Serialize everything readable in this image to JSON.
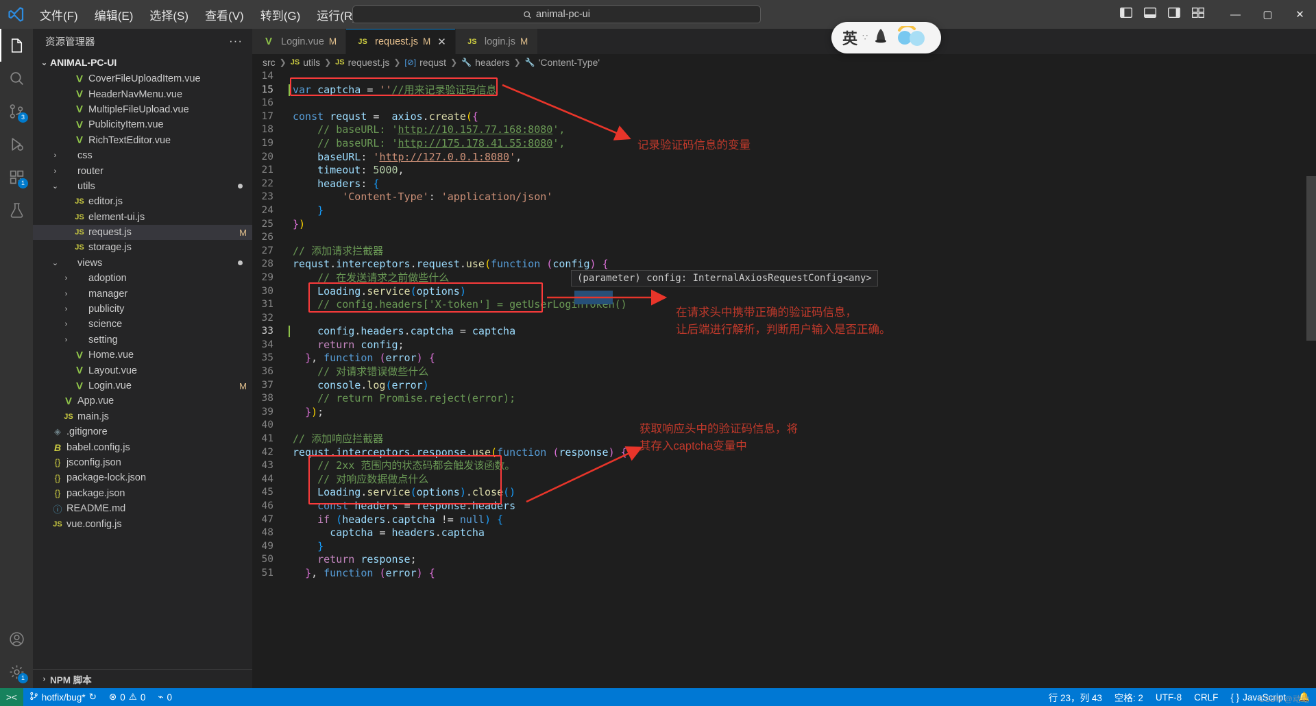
{
  "titlebar": {
    "menus": [
      "文件(F)",
      "编辑(E)",
      "选择(S)",
      "查看(V)",
      "转到(G)",
      "运行(R)"
    ],
    "more": "···",
    "search_placeholder": "animal-pc-ui",
    "search_icon": "search-icon",
    "back_icon": "←",
    "forward_icon": "→",
    "minimize": "—",
    "maximize": "▢",
    "close": "✕"
  },
  "activitybar": {
    "items": [
      {
        "name": "explorer",
        "badge": ""
      },
      {
        "name": "search",
        "badge": ""
      },
      {
        "name": "source-control",
        "badge": "3"
      },
      {
        "name": "run-debug",
        "badge": ""
      },
      {
        "name": "extensions",
        "badge": "1"
      },
      {
        "name": "testing",
        "badge": ""
      }
    ],
    "bottom": [
      {
        "name": "account",
        "badge": ""
      },
      {
        "name": "settings",
        "badge": "1"
      }
    ]
  },
  "sidebar": {
    "title": "资源管理器",
    "more": "···",
    "root": "ANIMAL-PC-UI",
    "root_twisty": "⌄",
    "tree": [
      {
        "indent": 2,
        "twisty": "",
        "icon": "vue",
        "label": "CoverFileUploadItem.vue",
        "mod": ""
      },
      {
        "indent": 2,
        "twisty": "",
        "icon": "vue",
        "label": "HeaderNavMenu.vue",
        "mod": ""
      },
      {
        "indent": 2,
        "twisty": "",
        "icon": "vue",
        "label": "MultipleFileUpload.vue",
        "mod": ""
      },
      {
        "indent": 2,
        "twisty": "",
        "icon": "vue",
        "label": "PublicityItem.vue",
        "mod": ""
      },
      {
        "indent": 2,
        "twisty": "",
        "icon": "vue",
        "label": "RichTextEditor.vue",
        "mod": ""
      },
      {
        "indent": 1,
        "twisty": "›",
        "icon": "",
        "label": "css",
        "mod": ""
      },
      {
        "indent": 1,
        "twisty": "›",
        "icon": "",
        "label": "router",
        "mod": ""
      },
      {
        "indent": 1,
        "twisty": "⌄",
        "icon": "",
        "label": "utils",
        "mod": "",
        "dot": true
      },
      {
        "indent": 2,
        "twisty": "",
        "icon": "js",
        "label": "editor.js",
        "mod": ""
      },
      {
        "indent": 2,
        "twisty": "",
        "icon": "js",
        "label": "element-ui.js",
        "mod": ""
      },
      {
        "indent": 2,
        "twisty": "",
        "icon": "js",
        "label": "request.js",
        "mod": "M",
        "selected": true
      },
      {
        "indent": 2,
        "twisty": "",
        "icon": "js",
        "label": "storage.js",
        "mod": ""
      },
      {
        "indent": 1,
        "twisty": "⌄",
        "icon": "",
        "label": "views",
        "mod": "",
        "dot": true
      },
      {
        "indent": 2,
        "twisty": "›",
        "icon": "",
        "label": "adoption",
        "mod": ""
      },
      {
        "indent": 2,
        "twisty": "›",
        "icon": "",
        "label": "manager",
        "mod": ""
      },
      {
        "indent": 2,
        "twisty": "›",
        "icon": "",
        "label": "publicity",
        "mod": ""
      },
      {
        "indent": 2,
        "twisty": "›",
        "icon": "",
        "label": "science",
        "mod": ""
      },
      {
        "indent": 2,
        "twisty": "›",
        "icon": "",
        "label": "setting",
        "mod": ""
      },
      {
        "indent": 2,
        "twisty": "",
        "icon": "vue",
        "label": "Home.vue",
        "mod": ""
      },
      {
        "indent": 2,
        "twisty": "",
        "icon": "vue",
        "label": "Layout.vue",
        "mod": ""
      },
      {
        "indent": 2,
        "twisty": "",
        "icon": "vue",
        "label": "Login.vue",
        "mod": "M"
      },
      {
        "indent": 1,
        "twisty": "",
        "icon": "vue",
        "label": "App.vue",
        "mod": ""
      },
      {
        "indent": 1,
        "twisty": "",
        "icon": "js",
        "label": "main.js",
        "mod": ""
      },
      {
        "indent": 0,
        "twisty": "",
        "icon": "git",
        "label": ".gitignore",
        "mod": ""
      },
      {
        "indent": 0,
        "twisty": "",
        "icon": "babel",
        "label": "babel.config.js",
        "mod": ""
      },
      {
        "indent": 0,
        "twisty": "",
        "icon": "json",
        "label": "jsconfig.json",
        "mod": ""
      },
      {
        "indent": 0,
        "twisty": "",
        "icon": "json",
        "label": "package-lock.json",
        "mod": ""
      },
      {
        "indent": 0,
        "twisty": "",
        "icon": "json",
        "label": "package.json",
        "mod": ""
      },
      {
        "indent": 0,
        "twisty": "",
        "icon": "md",
        "label": "README.md",
        "mod": ""
      },
      {
        "indent": 0,
        "twisty": "",
        "icon": "js",
        "label": "vue.config.js",
        "mod": ""
      }
    ],
    "npm_scripts": "NPM 脚本",
    "npm_twisty": "›"
  },
  "tabs": [
    {
      "icon": "vue",
      "label": "Login.vue",
      "mod": "M",
      "active": false,
      "close": ""
    },
    {
      "icon": "js",
      "label": "request.js",
      "mod": "M",
      "active": true,
      "close": "✕"
    },
    {
      "icon": "js",
      "label": "login.js",
      "mod": "M",
      "active": false,
      "close": ""
    }
  ],
  "breadcrumbs": [
    {
      "icon": "",
      "label": "src"
    },
    {
      "icon": "js",
      "label": "utils"
    },
    {
      "icon": "js",
      "label": "request.js"
    },
    {
      "icon": "object",
      "label": "requst"
    },
    {
      "icon": "prop",
      "label": "headers"
    },
    {
      "icon": "prop",
      "label": "'Content-Type'"
    }
  ],
  "editor": {
    "first_line": 14,
    "cursor_lines": [
      15,
      33
    ],
    "lines": [
      {
        "n": 14,
        "html": ""
      },
      {
        "n": 15,
        "html": "<span class=\"k\">var</span> <span class=\"v\">captcha</span> <span class=\"p\">=</span> <span class=\"s\">''</span><span class=\"c\">//用来记录验证码信息</span>"
      },
      {
        "n": 16,
        "html": ""
      },
      {
        "n": 17,
        "html": "<span class=\"k\">const</span> <span class=\"v\">requst</span> <span class=\"p\">=</span>  <span class=\"v\">axios</span><span class=\"p\">.</span><span class=\"f\">create</span><span class=\"br1\">(</span><span class=\"br2\">{</span>"
      },
      {
        "n": 18,
        "html": "    <span class=\"c\">// baseURL: '</span><span class=\"lnk\">http://10.157.77.168:8080</span><span class=\"c\">',</span>"
      },
      {
        "n": 19,
        "html": "    <span class=\"c\">// baseURL: '</span><span class=\"lnk\">http://175.178.41.55:8080</span><span class=\"c\">',</span>"
      },
      {
        "n": 20,
        "html": "    <span class=\"v\">baseURL</span><span class=\"p\">:</span> <span class=\"s\">'</span><span class=\"lnks\">http://127.0.0.1:8080</span><span class=\"s\">'</span><span class=\"p\">,</span>"
      },
      {
        "n": 21,
        "html": "    <span class=\"v\">timeout</span><span class=\"p\">:</span> <span class=\"n\">5000</span><span class=\"p\">,</span>"
      },
      {
        "n": 22,
        "html": "    <span class=\"v\">headers</span><span class=\"p\">:</span> <span class=\"br3\">{</span>"
      },
      {
        "n": 23,
        "html": "        <span class=\"s\">'Content-Type'</span><span class=\"p\">:</span> <span class=\"s\">'application/json'</span>"
      },
      {
        "n": 24,
        "html": "    <span class=\"br3\">}</span>"
      },
      {
        "n": 25,
        "html": "<span class=\"br2\">}</span><span class=\"br1\">)</span>"
      },
      {
        "n": 26,
        "html": ""
      },
      {
        "n": 27,
        "html": "<span class=\"c\">// 添加请求拦截器</span>"
      },
      {
        "n": 28,
        "html": "<span class=\"v\">requst</span><span class=\"p\">.</span><span class=\"v\">interceptors</span><span class=\"p\">.</span><span class=\"v\">request</span><span class=\"p\">.</span><span class=\"f\">use</span><span class=\"br1\">(</span><span class=\"k\">function</span> <span class=\"br2\">(</span><span class=\"v\">config</span><span class=\"br2\">)</span> <span class=\"br2\">{</span>"
      },
      {
        "n": 29,
        "html": "    <span class=\"c\">// 在发送请求之前做些什么</span>"
      },
      {
        "n": 30,
        "html": "    <span class=\"v\">Loading</span><span class=\"p\">.</span><span class=\"f\">service</span><span class=\"br3\">(</span><span class=\"v\">options</span><span class=\"br3\">)</span>"
      },
      {
        "n": 31,
        "html": "    <span class=\"c\">// config.headers['X-token'] = getUserLoginToken()</span>"
      },
      {
        "n": 32,
        "html": ""
      },
      {
        "n": 33,
        "html": "    <span class=\"v\">config</span><span class=\"p\">.</span><span class=\"v\">headers</span><span class=\"p\">.</span><span class=\"v\">captcha</span> <span class=\"p\">=</span> <span class=\"v\">captcha</span>"
      },
      {
        "n": 34,
        "html": "    <span class=\"kp\">return</span> <span class=\"v\">config</span><span class=\"p\">;</span>"
      },
      {
        "n": 35,
        "html": "  <span class=\"br2\">}</span><span class=\"p\">,</span> <span class=\"k\">function</span> <span class=\"br2\">(</span><span class=\"v\">error</span><span class=\"br2\">)</span> <span class=\"br2\">{</span>"
      },
      {
        "n": 36,
        "html": "    <span class=\"c\">// 对请求错误做些什么</span>"
      },
      {
        "n": 37,
        "html": "    <span class=\"v\">console</span><span class=\"p\">.</span><span class=\"f\">log</span><span class=\"br3\">(</span><span class=\"v\">error</span><span class=\"br3\">)</span>"
      },
      {
        "n": 38,
        "html": "    <span class=\"c\">// return Promise.reject(error);</span>"
      },
      {
        "n": 39,
        "html": "  <span class=\"br2\">}</span><span class=\"br1\">)</span><span class=\"p\">;</span>"
      },
      {
        "n": 40,
        "html": ""
      },
      {
        "n": 41,
        "html": "<span class=\"c\">// 添加响应拦截器</span>"
      },
      {
        "n": 42,
        "html": "<span class=\"v\">requst</span><span class=\"p\">.</span><span class=\"v\">interceptors</span><span class=\"p\">.</span><span class=\"v\">response</span><span class=\"p\">.</span><span class=\"f\">use</span><span class=\"br1\">(</span><span class=\"k\">function</span> <span class=\"br2\">(</span><span class=\"v\">response</span><span class=\"br2\">)</span> <span class=\"br2\">{</span>"
      },
      {
        "n": 43,
        "html": "    <span class=\"c\">// 2xx 范围内的状态码都会触发该函数。</span>"
      },
      {
        "n": 44,
        "html": "    <span class=\"c\">// 对响应数据做点什么</span>"
      },
      {
        "n": 45,
        "html": "    <span class=\"v\">Loading</span><span class=\"p\">.</span><span class=\"f\">service</span><span class=\"br3\">(</span><span class=\"v\">options</span><span class=\"br3\">)</span><span class=\"p\">.</span><span class=\"f\">close</span><span class=\"br3\">()</span>"
      },
      {
        "n": 46,
        "html": "    <span class=\"k\">const</span> <span class=\"v\">headers</span> <span class=\"p\">=</span> <span class=\"v\">response</span><span class=\"p\">.</span><span class=\"v\">headers</span>"
      },
      {
        "n": 47,
        "html": "    <span class=\"kp\">if</span> <span class=\"br3\">(</span><span class=\"v\">headers</span><span class=\"p\">.</span><span class=\"v\">captcha</span> <span class=\"p\">!=</span> <span class=\"k\">null</span><span class=\"br3\">)</span> <span class=\"br3\">{</span>"
      },
      {
        "n": 48,
        "html": "      <span class=\"v\">captcha</span> <span class=\"p\">=</span> <span class=\"v\">headers</span><span class=\"p\">.</span><span class=\"v\">captcha</span>"
      },
      {
        "n": 49,
        "html": "    <span class=\"br3\">}</span>"
      },
      {
        "n": 50,
        "html": "    <span class=\"kp\">return</span> <span class=\"v\">response</span><span class=\"p\">;</span>"
      },
      {
        "n": 51,
        "html": "  <span class=\"br2\">}</span><span class=\"p\">,</span> <span class=\"k\">function</span> <span class=\"br2\">(</span><span class=\"v\">error</span><span class=\"br2\">)</span> <span class=\"br2\">{</span>"
      }
    ],
    "tooltip": "(parameter) config: InternalAxiosRequestConfig<any>"
  },
  "annotations": [
    {
      "name": "annotation-1",
      "text": "记录验证码信息的变量"
    },
    {
      "name": "annotation-2",
      "text": "在请求头中携带正确的验证码信息，\n让后端进行解析，判断用户输入是否正确。"
    },
    {
      "name": "annotation-3",
      "text": "获取响应头中的验证码信息，将\n其存入captcha变量中"
    }
  ],
  "ime": {
    "lang": "英",
    "dots": "∵"
  },
  "statusbar": {
    "remote_icon": "><",
    "branch": "hotfix/bug*",
    "sync_icon": "↻",
    "errors": "0",
    "warnings": "0",
    "ports": "0",
    "error_icon": "⊗",
    "warning_icon": "⚠",
    "port_icon": "⌁",
    "position": "行 23，列 43",
    "spaces": "空格: 2",
    "encoding": "UTF-8",
    "eol": "CRLF",
    "language": "JavaScript",
    "lang_icon": "{ }",
    "bell_icon": "🔔",
    "watermark": "CSDN @动动"
  }
}
